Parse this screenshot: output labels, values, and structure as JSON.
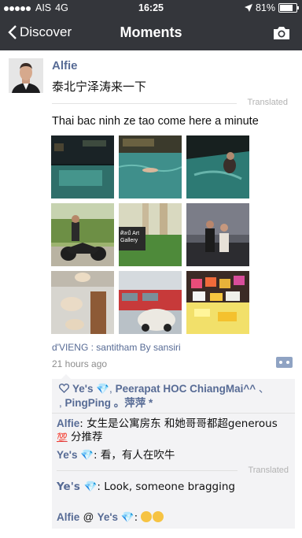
{
  "status": {
    "carrier": "AIS",
    "network": "4G",
    "time": "16:25",
    "battery": "81%",
    "battery_level": 0.81
  },
  "nav": {
    "back_label": "Discover",
    "title": "Moments"
  },
  "icons": {
    "back": "chevron-left-icon",
    "camera": "camera-icon",
    "location": "location-arrow-icon",
    "like": "heart-icon",
    "more": "more-icon"
  },
  "colors": {
    "bar": "#34363b",
    "link": "#576b95",
    "comment_bg": "#f3f3f5"
  },
  "post": {
    "author": "Alfie",
    "text": "泰北宁泽涛来一下",
    "translated_label": "Translated",
    "translation": "Thai bac ninh ze tao come here a minute",
    "location": "d'VIENG : santitham By sansiri",
    "time_ago": "21 hours ago",
    "photo_sign": "ศิลป์ Art Gallery"
  },
  "likes": {
    "names": [
      "Ye's 💎",
      "Peerapat HOC ChiangMai^^",
      "、",
      "PingPing 。萍萍 *"
    ]
  },
  "comments": {
    "c1": {
      "who": "Alfie",
      "text": "女生是公寓房东 和她哥哥都超generous",
      "text2": "分推荐",
      "badge": "💯"
    },
    "c2": {
      "who": "Ye's 💎",
      "text": "看，有人在吹牛"
    },
    "translated_label": "Translated",
    "c2_translation": {
      "who": "Ye's 💎",
      "text": "Look, someone bragging"
    },
    "c3": {
      "who": "Alfie",
      "at": "@",
      "to": "Ye's 💎",
      "text": ""
    }
  }
}
